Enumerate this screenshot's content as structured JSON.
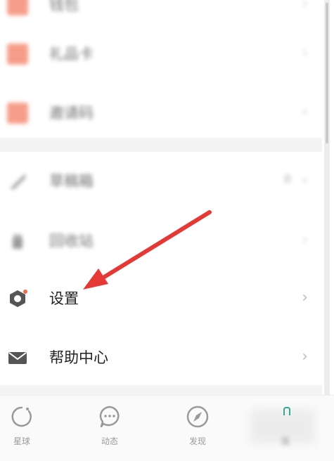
{
  "colors": {
    "accent_orange": "#f26a4b",
    "icon_gray": "#555555",
    "chevron": "#bdbdbd",
    "annotation_arrow": "#e53935"
  },
  "menu": {
    "items": [
      {
        "label": "钱包",
        "icon": "orange-square-icon",
        "blurred": true
      },
      {
        "label": "礼品卡",
        "icon": "orange-square-icon",
        "blurred": true
      },
      {
        "label": "邀请码",
        "icon": "orange-square-icon",
        "blurred": true
      },
      {
        "label": "草稿箱",
        "icon": "pen-icon",
        "blurred": true,
        "badge": "0"
      },
      {
        "label": "回收站",
        "icon": "trash-icon",
        "blurred": true
      },
      {
        "label": "设置",
        "icon": "settings-hexagon-icon",
        "blurred": false,
        "notification_dot": true
      },
      {
        "label": "帮助中心",
        "icon": "mail-icon",
        "blurred": false
      }
    ]
  },
  "bottom_nav": {
    "tabs": [
      {
        "label": "星球",
        "icon": "planet-ring-icon"
      },
      {
        "label": "动态",
        "icon": "chat-bubble-icon"
      },
      {
        "label": "发现",
        "icon": "compass-icon"
      },
      {
        "label": "我",
        "icon": "profile-icon",
        "blurred": true
      }
    ]
  }
}
